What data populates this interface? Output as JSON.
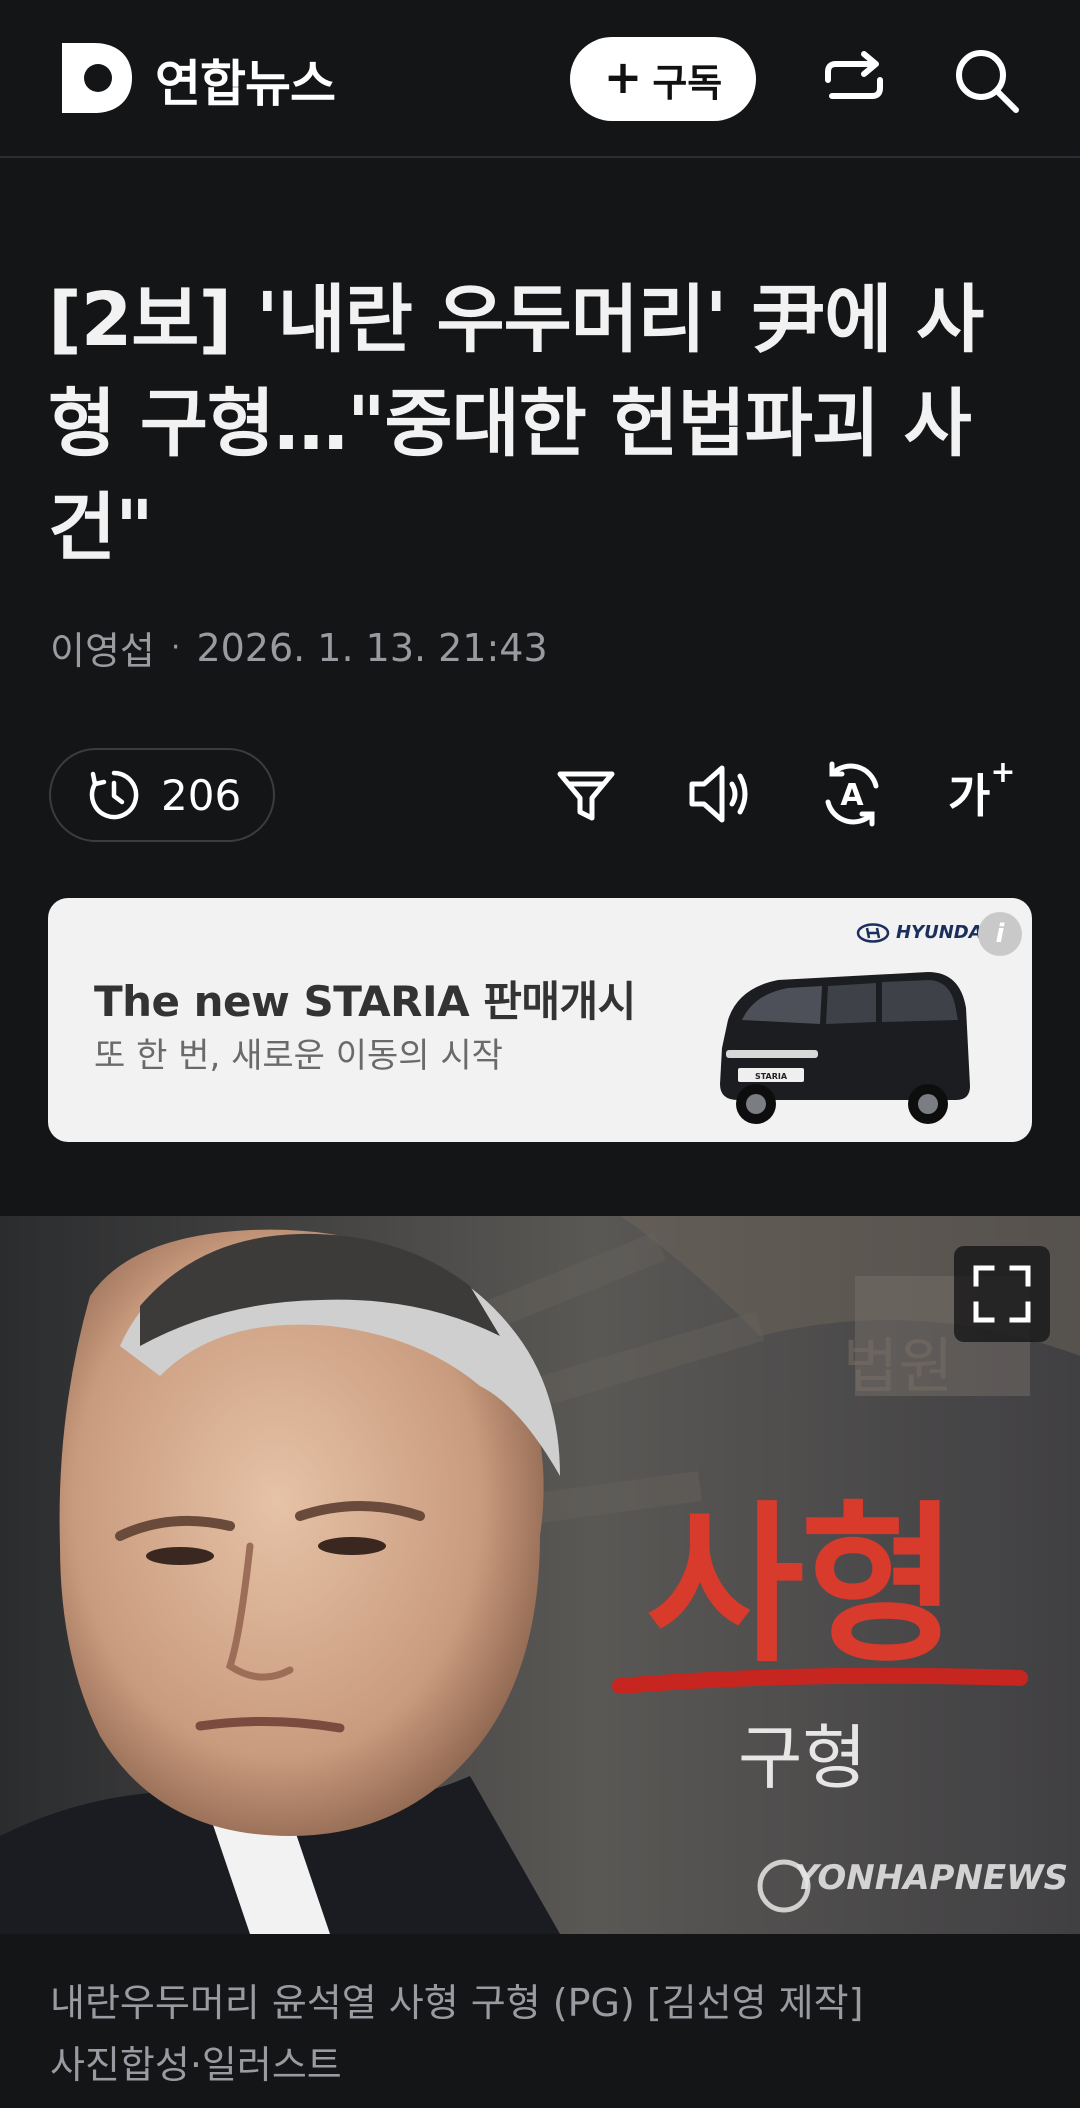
{
  "header": {
    "brand_name": "연합뉴스",
    "subscribe_label": "구독",
    "logo_icon": "d-logo-icon",
    "share_icon": "repost-icon",
    "search_icon": "search-icon"
  },
  "article": {
    "headline": "[2보] '내란 우두머리' 尹에 사형 구형…\"중대한 헌법파괴 사건\"",
    "author": "이영섭",
    "separator": "·",
    "datetime": "2026. 1. 13. 21:43"
  },
  "toolbar": {
    "summary_count": "206",
    "filter_icon": "filter-icon",
    "audio_icon": "speaker-icon",
    "translate_icon": "auto-translate-icon",
    "font_size_label": "가",
    "font_size_plus": "+"
  },
  "ad": {
    "title": "The new STARIA 판매개시",
    "subtitle": "또 한 번, 새로운 이동의 시작",
    "brand": "HYUNDAI",
    "info_label": "i",
    "plate_text": "STARIA"
  },
  "photo": {
    "overlay_main": "사형",
    "overlay_sub": "구형",
    "overlay_court": "법원",
    "watermark": "YONHAPNEWS",
    "expand_icon": "fullscreen-icon"
  },
  "caption": {
    "line1": "내란우두머리 윤석열 사형 구형 (PG) [김선영 제작]",
    "line2": "사진합성·일러스트"
  }
}
